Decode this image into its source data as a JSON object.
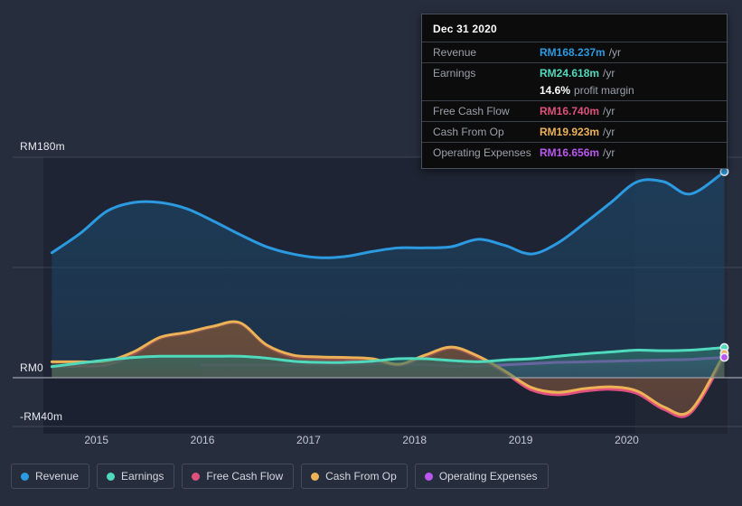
{
  "chart_data": {
    "type": "area",
    "title": "",
    "xlabel": "",
    "ylabel": "",
    "currency_prefix": "RM",
    "unit_suffix": "m",
    "ylim": [
      -40,
      180
    ],
    "xlim": [
      2014.5,
      2020.95
    ],
    "grid": true,
    "gridlines": [
      180,
      90,
      0,
      -40
    ],
    "ytick_labels": [
      "RM180m",
      "RM0",
      "-RM40m"
    ],
    "ytick_values": [
      180,
      0,
      -40
    ],
    "xtick_labels": [
      "2015",
      "2016",
      "2017",
      "2018",
      "2019",
      "2020"
    ],
    "xtick_values": [
      2015,
      2016,
      2017,
      2018,
      2019,
      2020
    ],
    "legend_position": "bottom-left",
    "highlight_band_start": 2020.08,
    "series": [
      {
        "name": "Revenue",
        "color": "#2b9ae0",
        "fill": "#1d4363",
        "x": [
          2014.58,
          2014.85,
          2015.1,
          2015.35,
          2015.6,
          2015.85,
          2016.1,
          2016.35,
          2016.6,
          2016.85,
          2017.1,
          2017.35,
          2017.6,
          2017.85,
          2018.1,
          2018.35,
          2018.6,
          2018.85,
          2019.1,
          2019.35,
          2019.6,
          2019.85,
          2020.1,
          2020.35,
          2020.6,
          2020.92
        ],
        "values": [
          102,
          118,
          136,
          143,
          143,
          138,
          128,
          117,
          107,
          101,
          98,
          99,
          103,
          106,
          106,
          107,
          113,
          108,
          101,
          110,
          126,
          143,
          160,
          160,
          150,
          168.237
        ]
      },
      {
        "name": "Earnings",
        "color": "#4fd9bd",
        "fill": "#2e6f68",
        "x": [
          2014.58,
          2014.85,
          2015.1,
          2015.35,
          2015.6,
          2015.85,
          2016.1,
          2016.35,
          2016.6,
          2016.85,
          2017.1,
          2017.35,
          2017.6,
          2017.85,
          2018.1,
          2018.35,
          2018.6,
          2018.85,
          2019.1,
          2019.35,
          2019.6,
          2019.85,
          2020.1,
          2020.35,
          2020.6,
          2020.92
        ],
        "values": [
          9.0,
          12.0,
          14.5,
          16.5,
          17.5,
          17.5,
          17.5,
          17.5,
          16.0,
          13.5,
          12.5,
          12.5,
          13.5,
          15.5,
          15.5,
          14.0,
          13.0,
          14.5,
          15.5,
          17.5,
          19.5,
          21.0,
          22.5,
          22.0,
          22.5,
          24.618
        ]
      },
      {
        "name": "Free Cash Flow",
        "color": "#e0507e",
        "fill": "#6d3346",
        "x": [
          2014.58,
          2014.85,
          2015.1,
          2015.35,
          2015.6,
          2015.85,
          2016.1,
          2016.35,
          2016.6,
          2016.85,
          2017.1,
          2017.35,
          2017.6,
          2017.85,
          2018.1,
          2018.35,
          2018.6,
          2018.85,
          2019.1,
          2019.35,
          2019.6,
          2019.85,
          2020.1,
          2020.35,
          2020.6,
          2020.92
        ],
        "values": [
          9.0,
          9.5,
          10.5,
          19.0,
          32.0,
          36.0,
          41.0,
          44.0,
          26.0,
          17.0,
          15.5,
          15.0,
          14.5,
          10.0,
          17.0,
          24.0,
          16.0,
          4.0,
          -10.0,
          -14.0,
          -11.0,
          -9.5,
          -13.0,
          -26.0,
          -29.0,
          16.74
        ]
      },
      {
        "name": "Cash From Op",
        "color": "#eeb256",
        "fill": "#6b5637",
        "x": [
          2014.58,
          2014.85,
          2015.1,
          2015.35,
          2015.6,
          2015.85,
          2016.1,
          2016.35,
          2016.6,
          2016.85,
          2017.1,
          2017.35,
          2017.6,
          2017.85,
          2018.1,
          2018.35,
          2018.6,
          2018.85,
          2019.1,
          2019.35,
          2019.6,
          2019.85,
          2020.1,
          2020.35,
          2020.6,
          2020.92
        ],
        "values": [
          13.0,
          13.0,
          13.5,
          21.0,
          33.0,
          37.0,
          42.0,
          45.0,
          27.0,
          18.5,
          17.0,
          16.5,
          15.5,
          11.0,
          18.5,
          25.0,
          17.5,
          5.5,
          -8.0,
          -12.0,
          -9.0,
          -7.5,
          -11.0,
          -24.0,
          -27.0,
          19.923
        ]
      },
      {
        "name": "Operating Expenses",
        "color": "#b957f0",
        "fill": "#45407a",
        "x": [
          2016.0,
          2016.35,
          2016.6,
          2016.85,
          2017.1,
          2017.35,
          2017.6,
          2017.85,
          2018.1,
          2018.35,
          2018.6,
          2018.85,
          2019.1,
          2019.35,
          2019.6,
          2019.85,
          2020.1,
          2020.35,
          2020.6,
          2020.92
        ],
        "values": [
          10.5,
          10.5,
          10.5,
          10.5,
          10.5,
          10.5,
          11.0,
          11.0,
          10.5,
          9.5,
          9.5,
          10.5,
          11.5,
          12.5,
          13.0,
          13.5,
          14.0,
          14.5,
          15.0,
          16.656
        ]
      }
    ]
  },
  "tooltip": {
    "date": "Dec 31 2020",
    "rows": [
      {
        "label": "Revenue",
        "value": "RM168.237m",
        "unit": "/yr",
        "color": "#2b9ae0"
      },
      {
        "label": "Earnings",
        "value": "RM24.618m",
        "unit": "/yr",
        "color": "#4fd9bd"
      },
      {
        "label": "",
        "value": "14.6%",
        "unit": "profit margin",
        "color": "#ffffff"
      },
      {
        "label": "Free Cash Flow",
        "value": "RM16.740m",
        "unit": "/yr",
        "color": "#e0507e"
      },
      {
        "label": "Cash From Op",
        "value": "RM19.923m",
        "unit": "/yr",
        "color": "#eeb256"
      },
      {
        "label": "Operating Expenses",
        "value": "RM16.656m",
        "unit": "/yr",
        "color": "#b957f0"
      }
    ]
  },
  "legend": {
    "items": [
      {
        "label": "Revenue",
        "color": "#2b9ae0"
      },
      {
        "label": "Earnings",
        "color": "#4fd9bd"
      },
      {
        "label": "Free Cash Flow",
        "color": "#e0507e"
      },
      {
        "label": "Cash From Op",
        "color": "#eeb256"
      },
      {
        "label": "Operating Expenses",
        "color": "#b957f0"
      }
    ]
  },
  "theme": {
    "background": "#262d3d",
    "plot_positive": "#1e2433",
    "plot_negative": "#1b2130",
    "gridline": "#4a5163",
    "zeroline": "#9aa0ab",
    "axis_text": "#c2c8d4"
  }
}
